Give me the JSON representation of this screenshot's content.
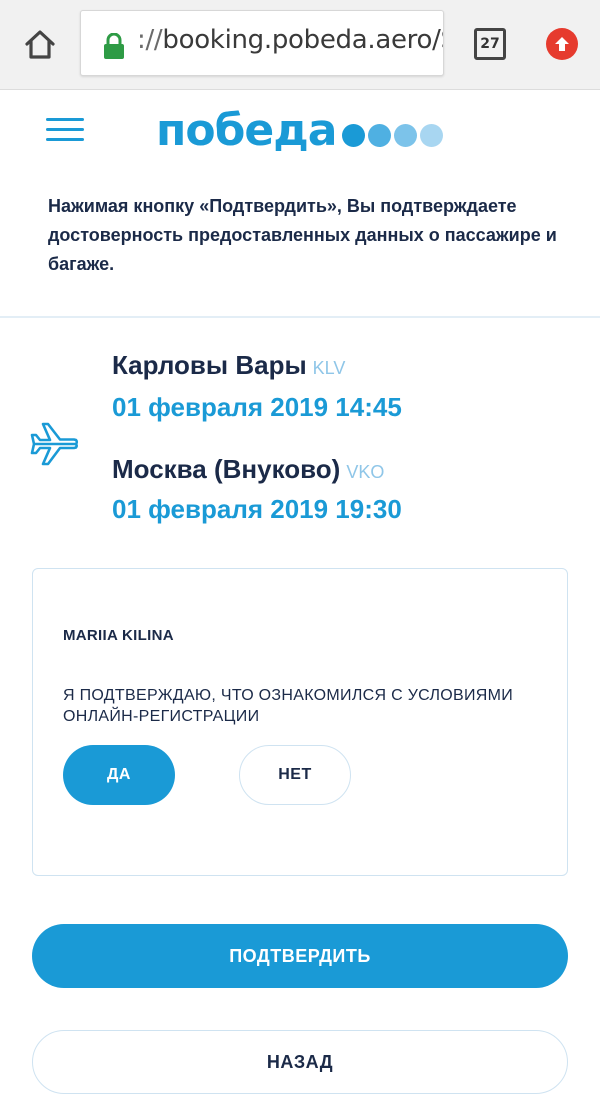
{
  "browser": {
    "url_scheme": "://",
    "url_host": "booking.pobeda.aero/S",
    "tab_count": "27"
  },
  "header": {
    "logo_text": "победа",
    "logo_dot_colors": [
      "#1a9ad6",
      "#4fb0e2",
      "#7cc3ea",
      "#a8d6f1"
    ]
  },
  "intro_text": "Нажимая кнопку «Подтвердить», Вы подтверждаете достоверность предоставленных данных о пассажире и багаже.",
  "flight": {
    "departure": {
      "city": "Карловы Вары",
      "code": "KLV",
      "datetime": "01 февраля 2019 14:45"
    },
    "arrival": {
      "city": "Москва (Внуково)",
      "code": "VKO",
      "datetime": "01 февраля 2019 19:30"
    }
  },
  "passenger": {
    "name": "MARIIA KILINA",
    "confirm_text": "Я ПОДТВЕРЖДАЮ, ЧТО ОЗНАКОМИЛСЯ С УСЛОВИЯМИ ОНЛАЙН-РЕГИСТРАЦИИ",
    "yes_label": "ДА",
    "no_label": "НЕТ",
    "selected": "yes"
  },
  "actions": {
    "confirm_label": "ПОДТВЕРДИТЬ",
    "back_label": "НАЗАД"
  },
  "colors": {
    "accent": "#1a9ad6",
    "text": "#1b2a48",
    "code": "#8fc6e8"
  }
}
